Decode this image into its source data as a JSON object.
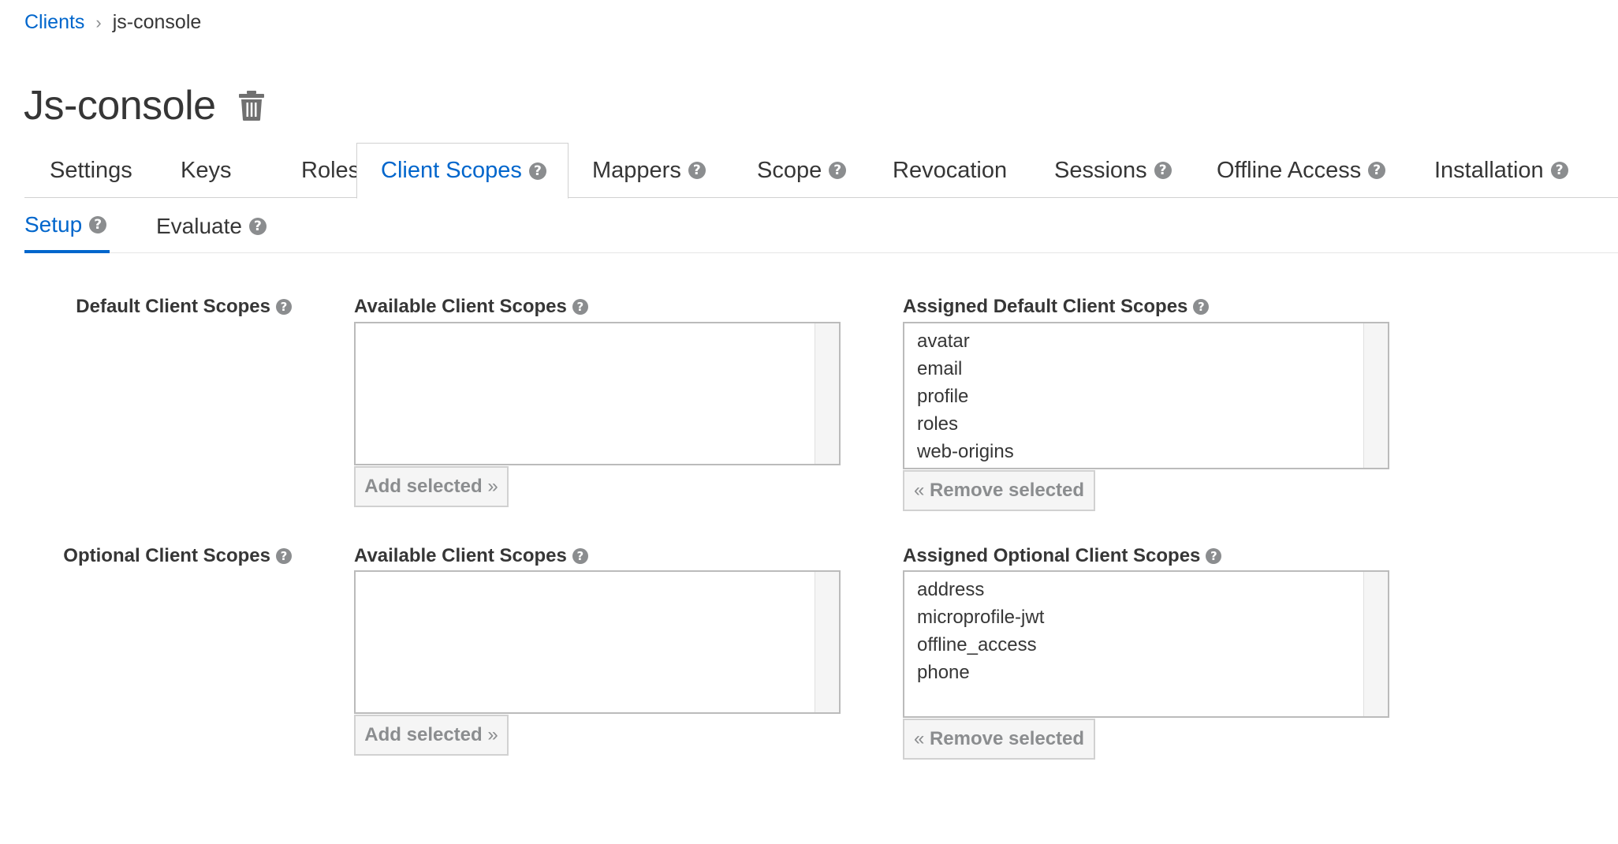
{
  "breadcrumb": {
    "parent": "Clients",
    "separator": "›",
    "current": "js-console"
  },
  "page": {
    "title": "Js-console"
  },
  "tabs": [
    {
      "label": "Settings",
      "help": false
    },
    {
      "label": "Keys",
      "help": false
    },
    {
      "label": "Roles",
      "help": false
    },
    {
      "label": "Client Scopes",
      "help": true,
      "active": true
    },
    {
      "label": "Mappers",
      "help": true
    },
    {
      "label": "Scope",
      "help": true
    },
    {
      "label": "Revocation",
      "help": false
    },
    {
      "label": "Sessions",
      "help": true
    },
    {
      "label": "Offline Access",
      "help": true
    },
    {
      "label": "Installation",
      "help": true
    }
  ],
  "subtabs": [
    {
      "label": "Setup",
      "active": true
    },
    {
      "label": "Evaluate"
    }
  ],
  "default_scopes": {
    "row_label": "Default Client Scopes",
    "available_label": "Available Client Scopes",
    "available_items": [],
    "add_button": "Add selected",
    "assigned_label": "Assigned Default Client Scopes",
    "assigned_items": [
      "avatar",
      "email",
      "profile",
      "roles",
      "web-origins"
    ],
    "remove_button": "Remove selected"
  },
  "optional_scopes": {
    "row_label": "Optional Client Scopes",
    "available_label": "Available Client Scopes",
    "available_items": [],
    "add_button": "Add selected",
    "assigned_label": "Assigned Optional Client Scopes",
    "assigned_items": [
      "address",
      "microprofile-jwt",
      "offline_access",
      "phone"
    ],
    "remove_button": "Remove selected"
  },
  "icons": {
    "help": "question-circle-icon",
    "delete": "trash-icon",
    "add": "double-chevron-right-icon",
    "remove": "double-chevron-left-icon"
  },
  "colors": {
    "link": "#0066cc",
    "text": "#363636",
    "muted": "#8b8d8f",
    "border": "#d1d1d1"
  }
}
